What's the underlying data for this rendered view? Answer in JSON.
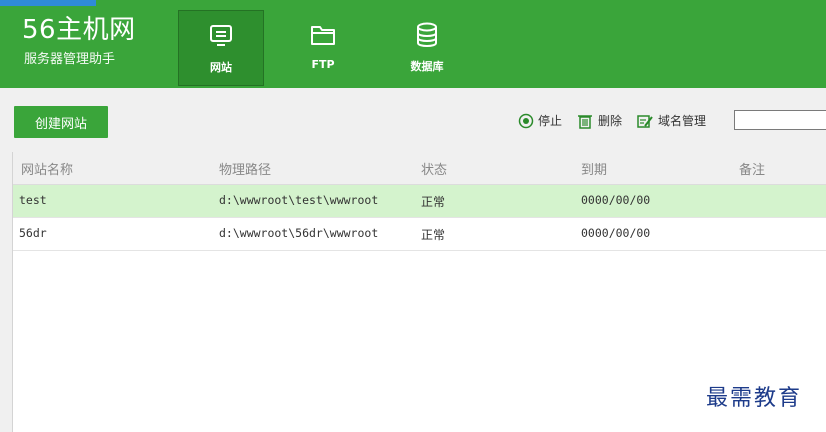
{
  "app": {
    "title": "56主机网",
    "subtitle": "服务器管理助手"
  },
  "nav": [
    {
      "label": "网站",
      "icon": "monitor-icon",
      "active": true
    },
    {
      "label": "FTP",
      "icon": "folder-icon",
      "active": false
    },
    {
      "label": "数据库",
      "icon": "database-icon",
      "active": false
    }
  ],
  "actions": {
    "create_site": "创建网站",
    "stop": "停止",
    "delete": "删除",
    "domain_manage": "域名管理",
    "domain_input_value": ""
  },
  "table": {
    "headers": [
      "网站名称",
      "物理路径",
      "状态",
      "到期",
      "备注"
    ],
    "rows": [
      {
        "name": "test",
        "path": "d:\\wwwroot\\test\\wwwroot",
        "status": "正常",
        "expiry": "0000/00/00",
        "note": ""
      },
      {
        "name": "56dr",
        "path": "d:\\wwwroot\\56dr\\wwwroot",
        "status": "正常",
        "expiry": "0000/00/00",
        "note": ""
      }
    ]
  },
  "watermark": "最需教育",
  "colors": {
    "header_green": "#3aa53a",
    "active_tab": "#2e8f2e",
    "selected_row": "#d4f3cd"
  }
}
